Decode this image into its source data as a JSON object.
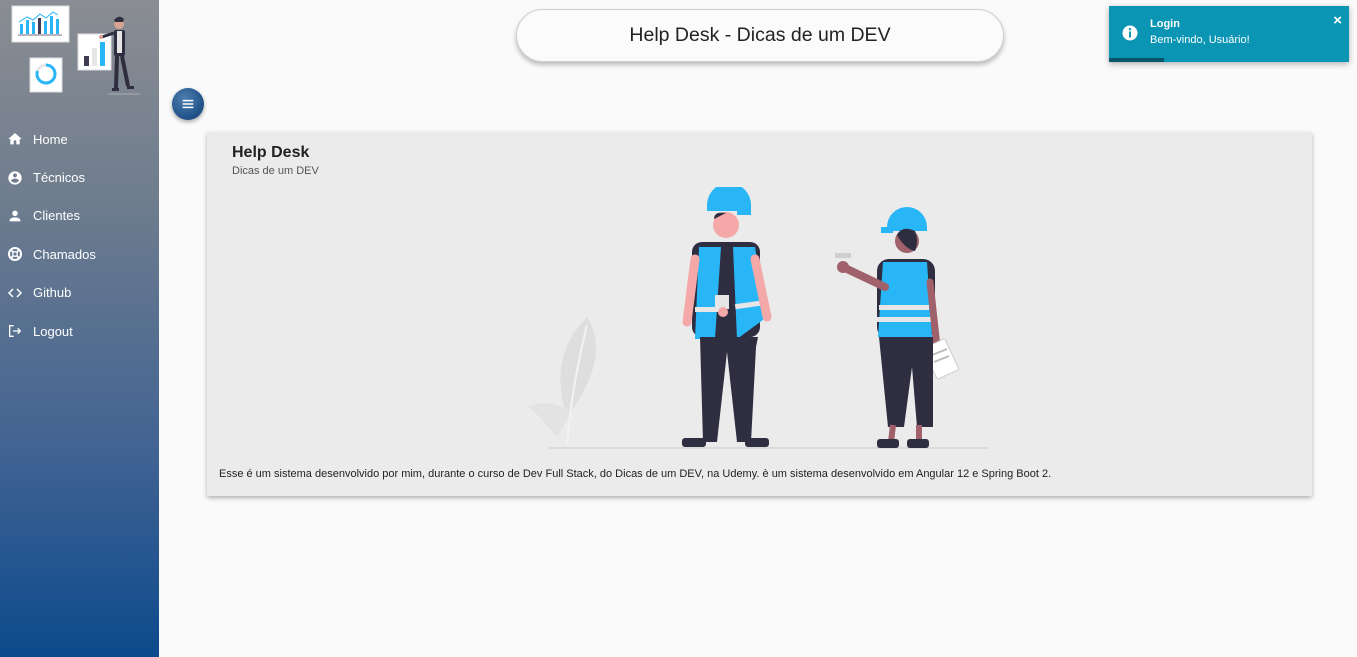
{
  "header": {
    "title": "Help Desk - Dicas de um DEV"
  },
  "sidebar": {
    "items": [
      {
        "label": "Home",
        "icon": "home-icon"
      },
      {
        "label": "Técnicos",
        "icon": "account-circle-icon"
      },
      {
        "label": "Clientes",
        "icon": "person-icon"
      },
      {
        "label": "Chamados",
        "icon": "support-icon"
      },
      {
        "label": "Github",
        "icon": "code-icon"
      },
      {
        "label": "Logout",
        "icon": "logout-icon"
      }
    ]
  },
  "toast": {
    "title": "Login",
    "message": "Bem-vindo, Usuário!",
    "close": "×",
    "progress": 0.23
  },
  "card": {
    "title": "Help Desk",
    "subtitle": "Dicas de um DEV",
    "description": "Esse é um sistema desenvolvido por mim, durante o curso de Dev Full Stack, do Dicas de um DEV, na Udemy. è um sistema desenvolvido em Angular 12 e Spring Boot 2."
  },
  "colors": {
    "sidebar_top": "#8a8d93",
    "sidebar_bottom": "#0c4a8c",
    "toast_bg": "#0b95b5",
    "accent": "#29b6f6"
  }
}
